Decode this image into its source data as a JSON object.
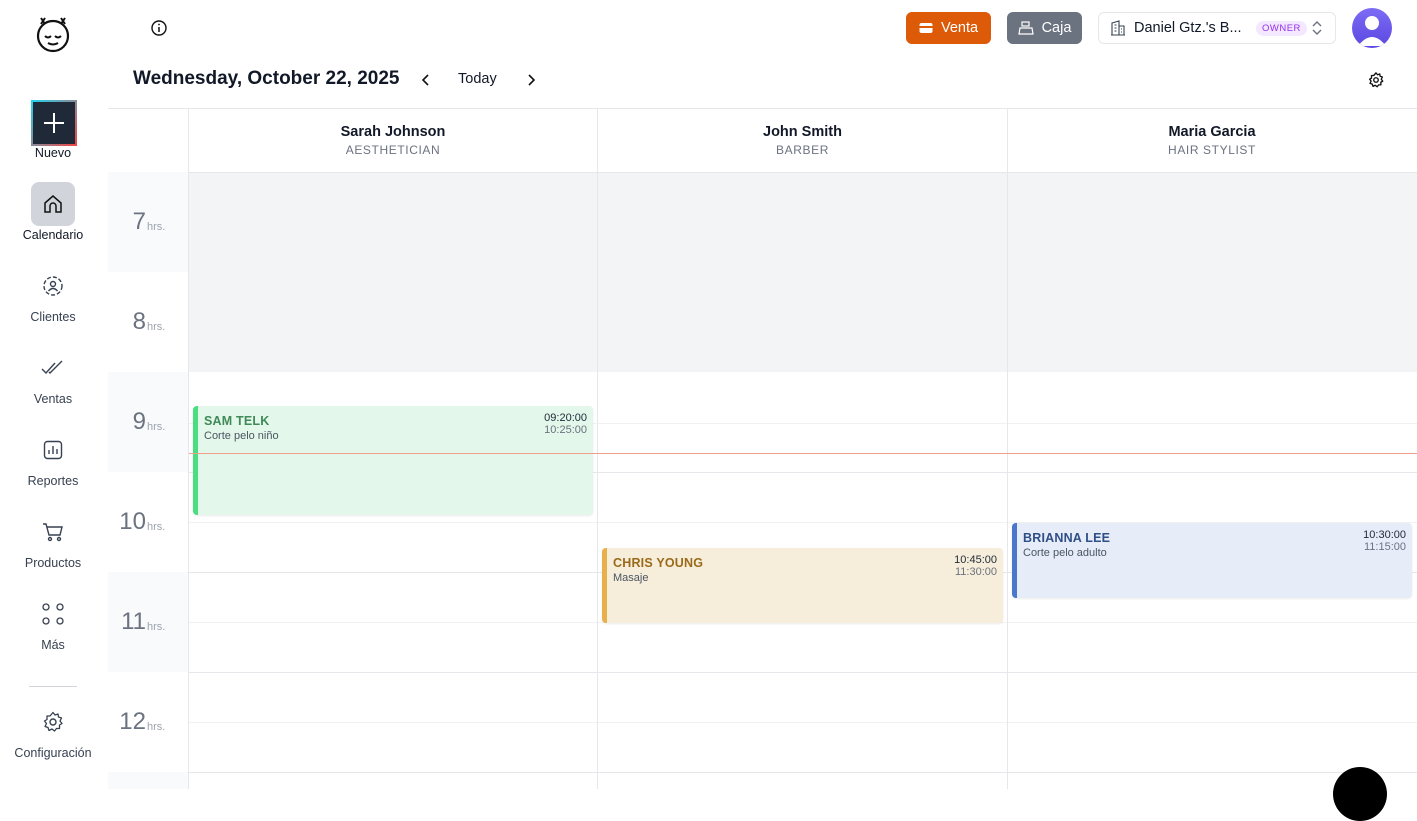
{
  "sidebar": {
    "items": [
      {
        "label": "Nuevo",
        "icon": "plus-icon"
      },
      {
        "label": "Calendario",
        "icon": "home-icon"
      },
      {
        "label": "Clientes",
        "icon": "clients-gear-icon"
      },
      {
        "label": "Ventas",
        "icon": "double-check-icon"
      },
      {
        "label": "Reportes",
        "icon": "bar-chart-icon"
      },
      {
        "label": "Productos",
        "icon": "cart-icon"
      },
      {
        "label": "Más",
        "icon": "grid-dots-icon"
      }
    ],
    "settings_label": "Configuración"
  },
  "header": {
    "venta_label": "Venta",
    "caja_label": "Caja",
    "business_name": "Daniel Gtz.'s B...",
    "business_role": "OWNER",
    "date_title": "Wednesday, October 22, 2025",
    "today_label": "Today"
  },
  "staff": [
    {
      "name": "Sarah Johnson",
      "role": "AESTHETICIAN"
    },
    {
      "name": "John Smith",
      "role": "BARBER"
    },
    {
      "name": "Maria Garcia",
      "role": "HAIR STYLIST"
    }
  ],
  "hours": [
    {
      "num": "7",
      "suffix": "hrs."
    },
    {
      "num": "8",
      "suffix": "hrs."
    },
    {
      "num": "9",
      "suffix": "hrs."
    },
    {
      "num": "10",
      "suffix": "hrs."
    },
    {
      "num": "11",
      "suffix": "hrs."
    },
    {
      "num": "12",
      "suffix": "hrs."
    }
  ],
  "appointments": [
    {
      "client": "SAM TELK",
      "service": "Corte pelo niño",
      "start": "09:20:00",
      "end": "10:25:00",
      "staff": "Sarah Johnson"
    },
    {
      "client": "CHRIS YOUNG",
      "service": "Masaje",
      "start": "10:45:00",
      "end": "11:30:00",
      "staff": "John Smith"
    },
    {
      "client": "BRIANNA LEE",
      "service": "Corte pelo adulto",
      "start": "10:30:00",
      "end": "11:15:00",
      "staff": "Maria Garcia"
    }
  ],
  "colors": {
    "venta": "#dc5a08",
    "caja": "#6b7280",
    "appt_green": "#4ade80",
    "appt_orange": "#e8b04c",
    "appt_blue": "#4a77c9",
    "now_line": "#f0a08a"
  }
}
